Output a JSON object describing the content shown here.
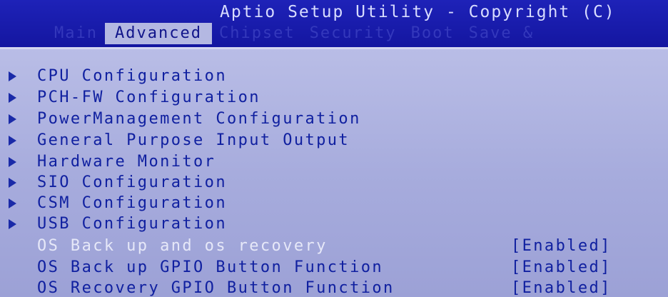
{
  "header": {
    "title": "Aptio Setup Utility - Copyright (C)",
    "tabs": [
      "Main",
      "Advanced",
      "Chipset",
      "Security",
      "Boot",
      "Save &"
    ]
  },
  "menu": {
    "submenus": [
      "CPU Configuration",
      "PCH-FW Configuration",
      "PowerManagement Configuration",
      "General Purpose Input Output",
      "Hardware Monitor",
      "SIO Configuration",
      "CSM Configuration",
      "USB Configuration"
    ],
    "settings": [
      {
        "label": "OS Back up and os recovery",
        "value": "[Enabled]"
      },
      {
        "label": "OS Back up GPIO Button Function",
        "value": "[Enabled]"
      },
      {
        "label": "OS Recovery GPIO Button Function",
        "value": "[Enabled]"
      }
    ]
  },
  "colors": {
    "header_bg": "#1416a0",
    "content_bg": "#b0b4e2",
    "item_text": "#1020a0",
    "selected_tab_bg": "#b4b8e2",
    "highlight_text": "#e6e8f8"
  }
}
